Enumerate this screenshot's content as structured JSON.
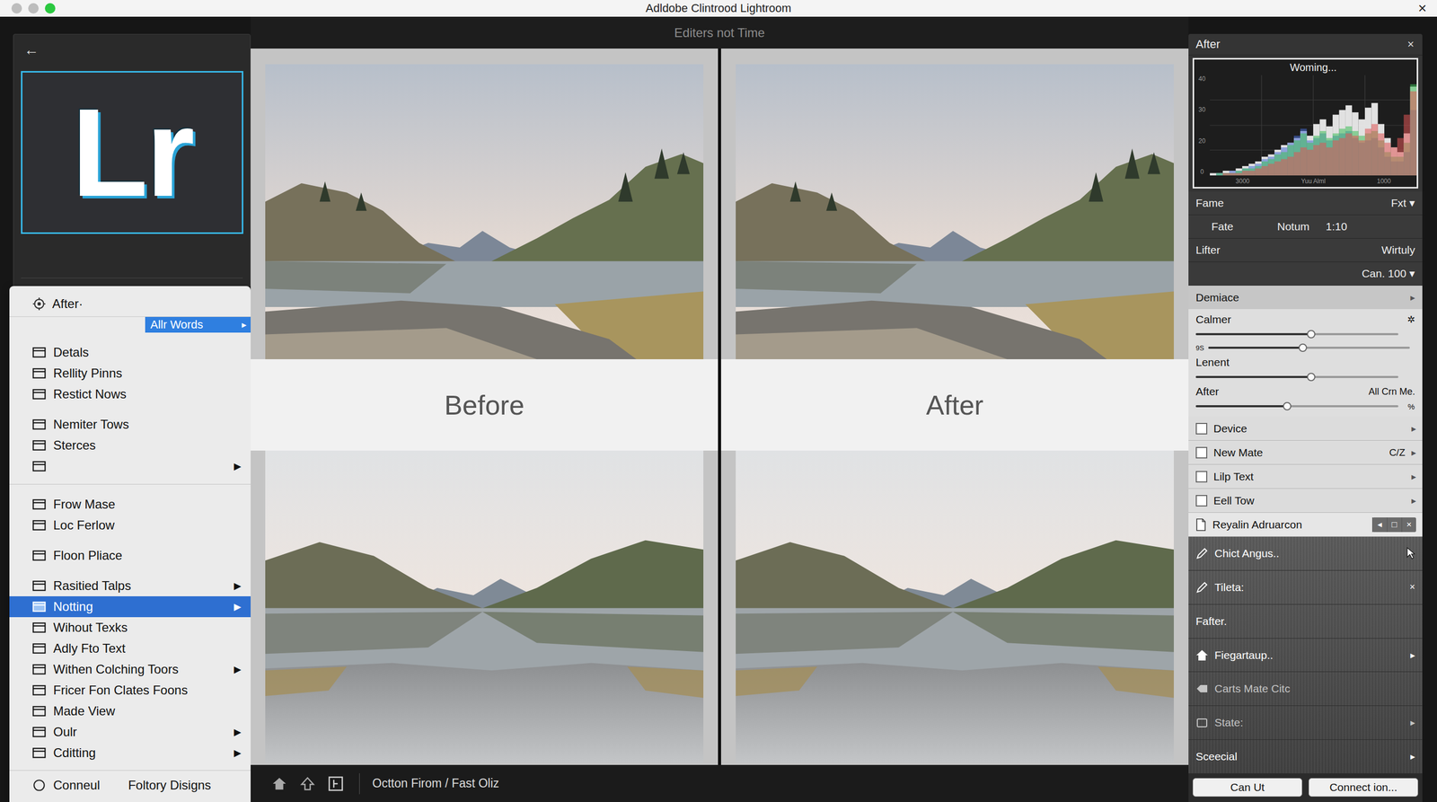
{
  "window": {
    "title": "Adldobe Clintrood Lightroom",
    "close": "×"
  },
  "toolbar": {
    "title": "Editers not Time"
  },
  "left_panel": {
    "back": "←",
    "logo": "Lr"
  },
  "menu": {
    "header": "After·",
    "submenu": {
      "label": "Allr Words",
      "arrow": "▸",
      "selected": true
    },
    "groups": [
      {
        "separator": false,
        "items": [
          {
            "label": "Detals",
            "arrow": "",
            "selected": false
          },
          {
            "label": "Rellity Pinns",
            "arrow": "",
            "selected": false
          },
          {
            "label": "Restict Nows",
            "arrow": "",
            "selected": false
          }
        ]
      },
      {
        "separator": true,
        "items": [
          {
            "label": "Nemiter Tows",
            "arrow": "",
            "selected": false
          },
          {
            "label": "Sterces",
            "arrow": "",
            "selected": false
          },
          {
            "label": "",
            "arrow": "▶",
            "selected": false
          }
        ]
      },
      {
        "separator": false,
        "items": [
          {
            "label": "Frow Mase",
            "arrow": "",
            "selected": false
          },
          {
            "label": "Loc Ferlow",
            "arrow": "",
            "selected": false
          }
        ]
      },
      {
        "separator": false,
        "items": [
          {
            "label": "Floon Pliace",
            "arrow": "",
            "selected": false
          }
        ]
      },
      {
        "separator": false,
        "items": [
          {
            "label": "Rasitied Talps",
            "arrow": "▶",
            "selected": false
          },
          {
            "label": "Notting",
            "arrow": "▶",
            "selected": true
          },
          {
            "label": "Wihout Texks",
            "arrow": "",
            "selected": false
          },
          {
            "label": "Adly Fto Text",
            "arrow": "",
            "selected": false
          },
          {
            "label": "Withen Colching Toors",
            "arrow": "▶",
            "selected": false
          },
          {
            "label": "Fricer Fon Clates Foons",
            "arrow": "",
            "selected": false
          },
          {
            "label": "Made View",
            "arrow": "",
            "selected": false
          },
          {
            "label": "Oulr",
            "arrow": "▶",
            "selected": false
          },
          {
            "label": "Cditting",
            "arrow": "▶",
            "selected": false
          }
        ]
      }
    ],
    "footer": {
      "left": "Conneul",
      "right": "Foltory Disigns"
    }
  },
  "compare": {
    "panes": [
      {
        "label": "Before"
      },
      {
        "label": "After"
      }
    ]
  },
  "bottom_bar": {
    "path": "Octton Firom / Fast Oliz"
  },
  "right_panel": {
    "header": {
      "title": "After",
      "close": "×"
    },
    "histogram": {
      "title": "Woming...",
      "y_ticks": [
        "40",
        "30",
        "20",
        "0"
      ],
      "x_ticks": [
        "3000",
        "Yuu Alml",
        "1000"
      ],
      "series": [
        {
          "name": "luminance",
          "color": "#ececec",
          "values": [
            1,
            1,
            2,
            2,
            3,
            4,
            5,
            6,
            8,
            9,
            11,
            13,
            14,
            16,
            19,
            17,
            22,
            24,
            21,
            26,
            28,
            30,
            27,
            24,
            29,
            31,
            22,
            16,
            12,
            10,
            18,
            38
          ]
        },
        {
          "name": "blue",
          "color": "#4a6fd6",
          "values": [
            0,
            1,
            1,
            2,
            2,
            3,
            4,
            5,
            7,
            8,
            10,
            12,
            14,
            17,
            20,
            15,
            16,
            18,
            15,
            17,
            18,
            19,
            16,
            14,
            15,
            16,
            12,
            8,
            6,
            6,
            10,
            28
          ]
        },
        {
          "name": "green",
          "color": "#3fbf5a",
          "values": [
            0,
            1,
            1,
            1,
            2,
            3,
            3,
            4,
            6,
            7,
            9,
            10,
            13,
            15,
            18,
            14,
            17,
            19,
            16,
            18,
            20,
            21,
            19,
            17,
            18,
            19,
            15,
            10,
            8,
            8,
            14,
            39
          ]
        },
        {
          "name": "red",
          "color": "#e05555",
          "values": [
            0,
            0,
            1,
            1,
            1,
            2,
            2,
            3,
            4,
            5,
            6,
            7,
            8,
            10,
            12,
            11,
            13,
            14,
            12,
            15,
            16,
            18,
            17,
            15,
            20,
            22,
            18,
            14,
            12,
            16,
            26,
            36
          ]
        }
      ]
    },
    "info_rows": [
      {
        "kind": "pair",
        "cells": [
          "Fame",
          "Fxt ▾"
        ]
      },
      {
        "kind": "triple",
        "cells": [
          "Fate",
          "Notum",
          "1:10"
        ]
      },
      {
        "kind": "pair",
        "cells": [
          "Lifter",
          "Wirtuly"
        ]
      },
      {
        "kind": "end",
        "cells": [
          "Can. 100 ▾"
        ]
      }
    ],
    "section": {
      "label": "Demiace",
      "arrow": "▸"
    },
    "sliders": [
      {
        "kind": "stacked",
        "label": "Calmer",
        "right": "✲",
        "note": "",
        "level": 0.57
      },
      {
        "kind": "inline",
        "label": "9S",
        "right": "",
        "note": "",
        "level": 0.47
      },
      {
        "kind": "stacked",
        "label": "Lenent",
        "right": "",
        "note": "",
        "level": 0.57
      },
      {
        "kind": "stacked",
        "label": "After",
        "right": "All Crn Me.",
        "note": "%",
        "level": 0.45
      }
    ],
    "list": [
      {
        "kind": "check",
        "label": "Device",
        "extra": "",
        "arrow": "▸",
        "checked": false,
        "controls": []
      },
      {
        "kind": "check",
        "label": "New Mate",
        "extra": "C/Z",
        "arrow": "▸",
        "checked": false,
        "controls": []
      },
      {
        "kind": "check",
        "label": "Lilp Text",
        "extra": "",
        "arrow": "▸",
        "checked": false,
        "controls": []
      },
      {
        "kind": "check",
        "label": "Eell Tow",
        "extra": "",
        "arrow": "▸",
        "checked": false,
        "controls": []
      },
      {
        "kind": "doc",
        "label": "Reyalin Adruarcon",
        "extra": "",
        "arrow": "",
        "checked": false,
        "controls": [
          "◂",
          "□",
          "×"
        ]
      }
    ],
    "tools": [
      {
        "kind": "tool",
        "label": "Chict Angus..",
        "trail": "",
        "disabled": false
      },
      {
        "kind": "tool",
        "label": "Tileta:",
        "trail": "×",
        "disabled": false
      },
      {
        "kind": "plain",
        "label": "Fafter.",
        "trail": "",
        "disabled": false
      },
      {
        "kind": "tool",
        "label": "Fiegartaup..",
        "trail": "▸",
        "disabled": false
      },
      {
        "kind": "tool",
        "label": "Carts Mate Citc",
        "trail": "",
        "disabled": true
      },
      {
        "kind": "tool",
        "label": "State:",
        "trail": "▸",
        "disabled": true
      },
      {
        "kind": "plain",
        "label": "Sceecial",
        "trail": "▸",
        "disabled": false
      }
    ],
    "buttons": [
      "Can Ut",
      "Connect ion..."
    ]
  }
}
